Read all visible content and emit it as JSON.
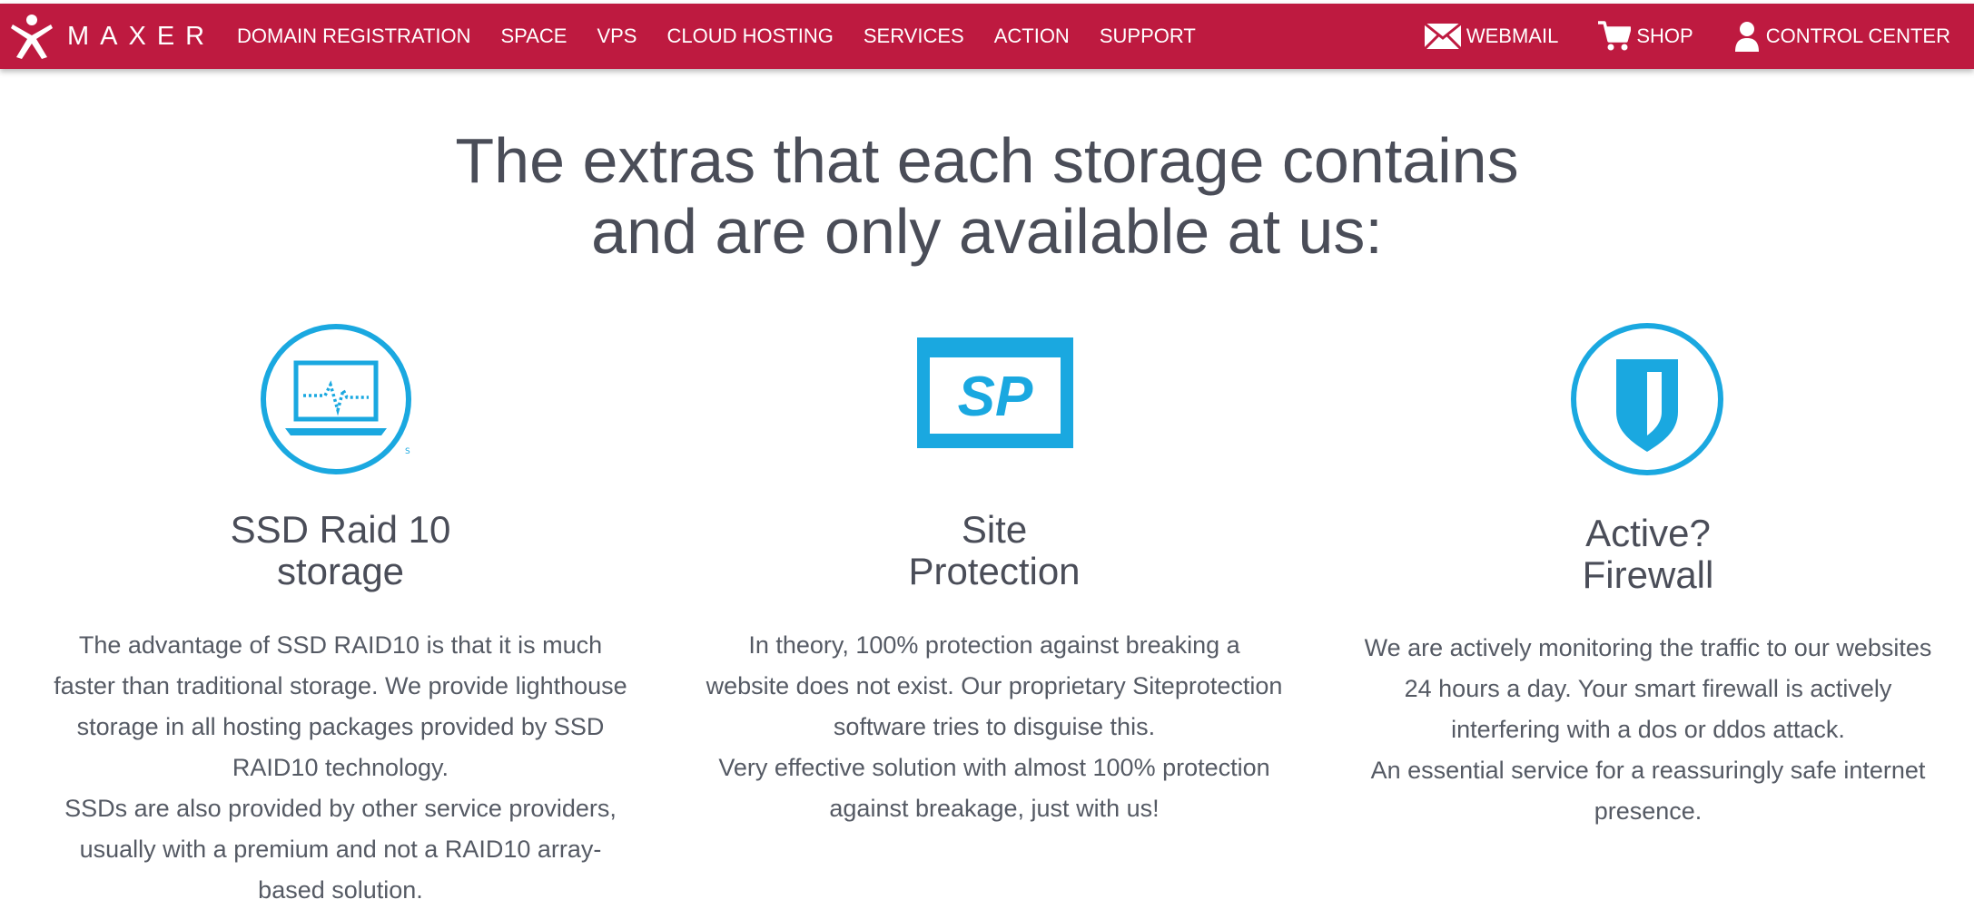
{
  "brand": {
    "name": "MAXER",
    "logo_icon": "person-star-logo-icon",
    "color": "#be1a40"
  },
  "nav": {
    "items": [
      {
        "label": "DOMAIN REGISTRATION"
      },
      {
        "label": "SPACE"
      },
      {
        "label": "VPS"
      },
      {
        "label": "CLOUD HOSTING"
      },
      {
        "label": "SERVICES"
      },
      {
        "label": "ACTION"
      },
      {
        "label": "SUPPORT"
      }
    ],
    "utility": [
      {
        "label": "WEBMAIL",
        "icon": "envelope-icon"
      },
      {
        "label": "SHOP",
        "icon": "cart-icon"
      },
      {
        "label": "CONTROL CENTER",
        "icon": "user-icon"
      }
    ]
  },
  "headline": {
    "line1": "The extras that each storage contains",
    "line2": "and are only available at us:"
  },
  "accent_color": "#1aa8e0",
  "features": [
    {
      "icon": "laptop-pulse-icon",
      "title_lines": [
        "SSD Raid 10",
        "storage"
      ],
      "desc_lines": [
        "The advantage of SSD RAID10 is that it is much",
        "faster than traditional storage. We provide lighthouse",
        "storage in all hosting packages provided by SSD",
        "RAID10 technology.",
        "SSDs are also provided by other service providers,",
        "usually with a premium and not a RAID10 array-",
        "based solution."
      ]
    },
    {
      "icon": "sp-shield-icon",
      "icon_text": "SP",
      "title_lines": [
        "Site",
        "Protection"
      ],
      "desc_lines": [
        "In theory, 100% protection against breaking a",
        "website does not exist. Our proprietary Siteprotection",
        "software tries to disguise this.",
        "Very effective solution with almost 100% protection",
        "against breakage, just with us!"
      ]
    },
    {
      "icon": "shield-icon",
      "title_lines": [
        "Active?",
        "Firewall"
      ],
      "desc_lines": [
        "We are actively monitoring the traffic to our websites",
        "24 hours a day. Your smart firewall is actively",
        "interfering with a dos or ddos attack.",
        "An essential service for a reassuringly safe internet",
        "presence."
      ]
    }
  ]
}
